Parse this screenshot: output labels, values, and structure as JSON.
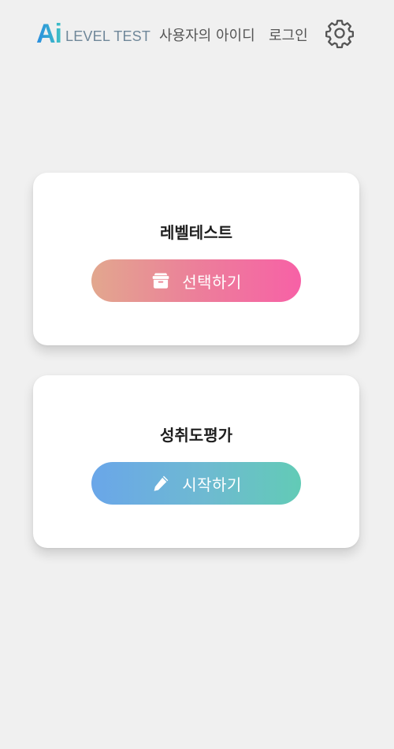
{
  "header": {
    "logo_ai": "Ai",
    "logo_text": "LEVEL TEST",
    "user_id": "사용자의 아이디",
    "login_label": "로그인",
    "settings_icon": "gear-icon"
  },
  "cards": {
    "level_test": {
      "title": "레벨테스트",
      "button_label": "선택하기",
      "button_icon": "archive-box-icon"
    },
    "achievement": {
      "title": "성취도평가",
      "button_label": "시작하기",
      "button_icon": "pencil-icon"
    }
  },
  "colors": {
    "background": "#f0f0f0",
    "select_gradient": [
      "#e2a78e",
      "#f761a6"
    ],
    "start_gradient": [
      "#6aa6e9",
      "#62cbb6"
    ],
    "logo_gradient": [
      "#2a8de0",
      "#3fc1c4"
    ]
  }
}
